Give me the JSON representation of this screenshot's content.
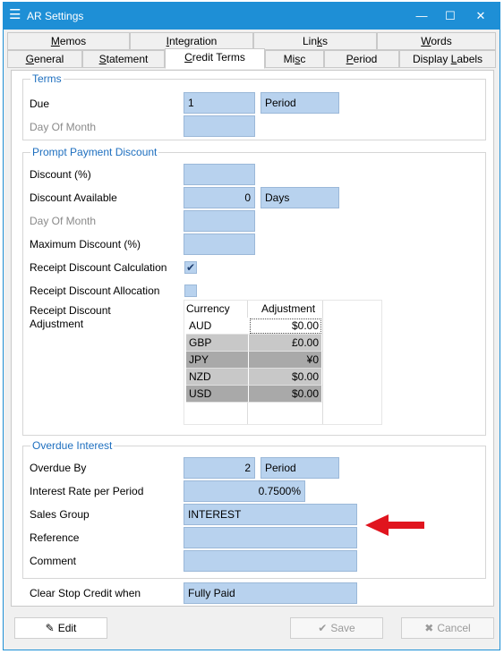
{
  "window": {
    "title": "AR Settings",
    "menu_icon": "hamburger-menu-icon",
    "controls": {
      "minimize": "—",
      "maximize": "☐",
      "close": "✕"
    }
  },
  "tabs": {
    "row1": [
      {
        "label": "Memos",
        "key": "M"
      },
      {
        "label": "Integration",
        "key": "I"
      },
      {
        "label": "Links",
        "key": "k"
      },
      {
        "label": "Words",
        "key": "W"
      }
    ],
    "row2": [
      {
        "label": "General",
        "key": "G"
      },
      {
        "label": "Statement",
        "key": "S"
      },
      {
        "label": "Credit Terms",
        "key": "C",
        "active": true
      },
      {
        "label": "Misc",
        "key": "s"
      },
      {
        "label": "Period",
        "key": "P"
      },
      {
        "label": "Display Labels",
        "key": "L"
      }
    ]
  },
  "terms": {
    "legend": "Terms",
    "due_label": "Due",
    "due_value": "1",
    "due_unit": "Period",
    "day_of_month_label": "Day Of Month",
    "day_of_month_value": ""
  },
  "prompt_payment": {
    "legend": "Prompt Payment Discount",
    "discount_label": "Discount (%)",
    "discount_value": "",
    "discount_available_label": "Discount Available",
    "discount_available_value": "0",
    "discount_available_unit": "Days",
    "day_of_month_label": "Day Of Month",
    "day_of_month_value": "",
    "max_discount_label": "Maximum Discount (%)",
    "max_discount_value": "",
    "receipt_calc_label": "Receipt Discount Calculation",
    "receipt_calc_checked": true,
    "receipt_alloc_label": "Receipt Discount Allocation",
    "receipt_alloc_checked": false,
    "receipt_adjust_label": "Receipt Discount\nAdjustment",
    "grid": {
      "columns": [
        "Currency",
        "Adjustment"
      ],
      "rows": [
        {
          "currency": "AUD",
          "adjustment": "$0.00"
        },
        {
          "currency": "GBP",
          "adjustment": "£0.00"
        },
        {
          "currency": "JPY",
          "adjustment": "¥0"
        },
        {
          "currency": "NZD",
          "adjustment": "$0.00"
        },
        {
          "currency": "USD",
          "adjustment": "$0.00"
        }
      ]
    }
  },
  "overdue": {
    "legend": "Overdue Interest",
    "overdue_by_label": "Overdue By",
    "overdue_by_value": "2",
    "overdue_by_unit": "Period",
    "interest_rate_label": "Interest Rate per Period",
    "interest_rate_value": "0.7500%",
    "sales_group_label": "Sales Group",
    "sales_group_value": "INTEREST",
    "reference_label": "Reference",
    "reference_value": "",
    "comment_label": "Comment",
    "comment_value": ""
  },
  "clear_stop_credit": {
    "label": "Clear Stop Credit when",
    "value": "Fully Paid",
    "arrow_color": "#e0141e"
  },
  "footer": {
    "edit_label": "Edit",
    "save_label": "Save",
    "cancel_label": "Cancel"
  },
  "colors": {
    "titlebar": "#1e8fd6",
    "field": "#b8d2ee",
    "legend_text": "#1e6fbf"
  }
}
